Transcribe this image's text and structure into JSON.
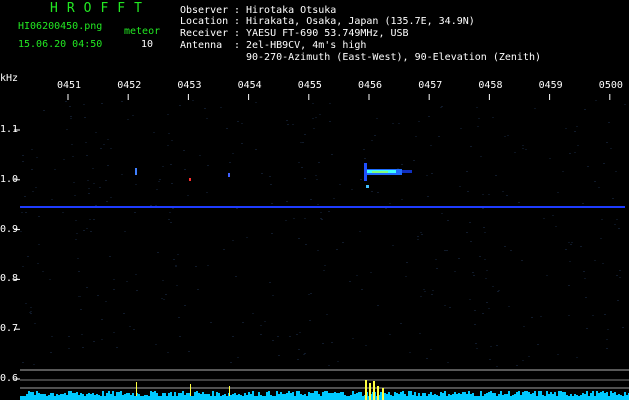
{
  "header": {
    "app_title": "HROFFT",
    "file_name": "HI06200450.png",
    "timestamp": "15.06.20 04:50",
    "meteor_label": "meteor",
    "meteor_count": "10"
  },
  "info": {
    "observer": {
      "label": "Observer",
      "sep": ":",
      "value": "Hirotaka Otsuka"
    },
    "location": {
      "label": "Location",
      "sep": ":",
      "value": "Hirakata, Osaka, Japan (135.7E, 34.9N)"
    },
    "receiver": {
      "label": "Receiver",
      "sep": ":",
      "value": "YAESU FT-690 53.749MHz, USB"
    },
    "antenna": {
      "label": "Antenna",
      "sep": ":",
      "value": "2el-HB9CV, 4m's high"
    },
    "antenna_2": "90-270-Azimuth (East-West), 90-Elevation (Zenith)"
  },
  "axis": {
    "y_unit": "kHz",
    "x_ticks": [
      "0451",
      "0452",
      "0453",
      "0454",
      "0455",
      "0456",
      "0457",
      "0458",
      "0459",
      "0500"
    ],
    "y_ticks": [
      "1.1",
      "1.0",
      "0.9",
      "0.8",
      "0.7",
      "0.6"
    ]
  },
  "colors": {
    "background": "#000000",
    "header_green": "#22e822",
    "signal_blue": "#1e3cff",
    "meteor_echo": "#40ffff",
    "noise_floor": "#00c8ff",
    "peak_marker": "#ffff40"
  }
}
